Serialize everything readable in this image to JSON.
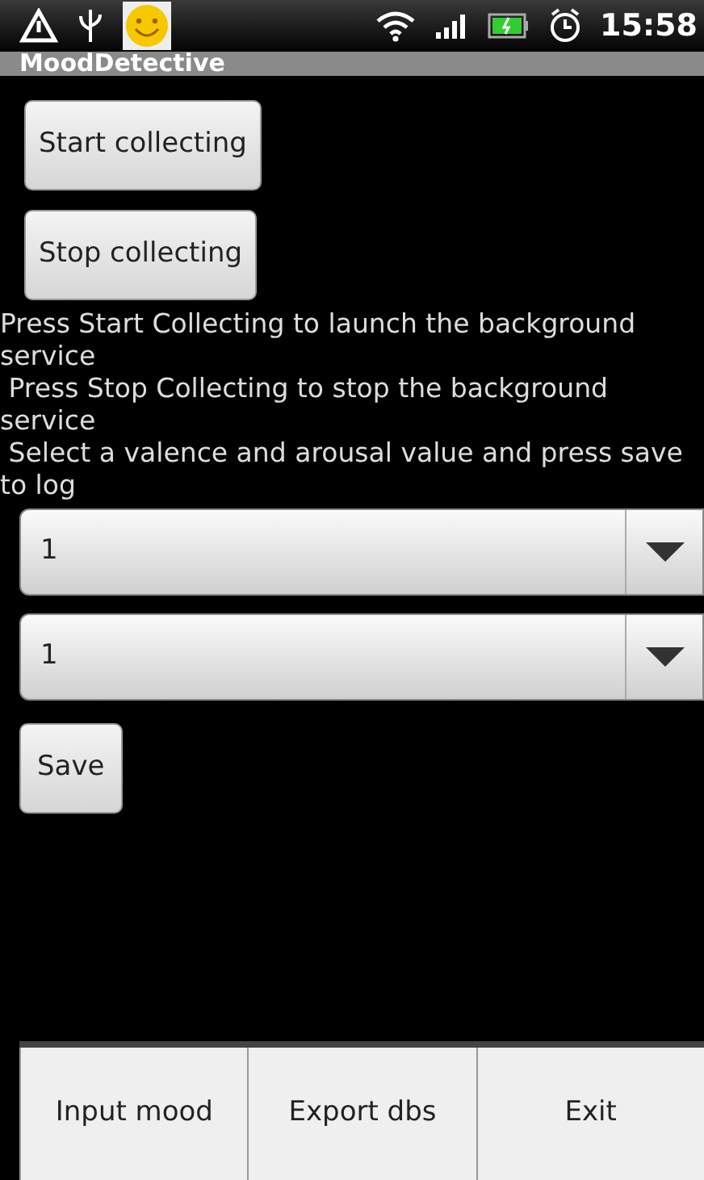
{
  "status_bar": {
    "time": "15:58"
  },
  "window": {
    "title": "MoodDetective"
  },
  "buttons": [
    {
      "label": "Start collecting"
    },
    {
      "label": "Stop collecting"
    }
  ],
  "instructions": [
    "Press Start Collecting to launch the background service",
    " Press Stop Collecting to stop the background service",
    " Select a valence and arousal value and press save to log"
  ],
  "selects": [
    {
      "value": "1"
    },
    {
      "value": "1"
    }
  ],
  "save_button": {
    "label": "Save"
  },
  "menu": [
    {
      "label": "Input mood"
    },
    {
      "label": "Export dbs"
    },
    {
      "label": "Exit"
    }
  ]
}
